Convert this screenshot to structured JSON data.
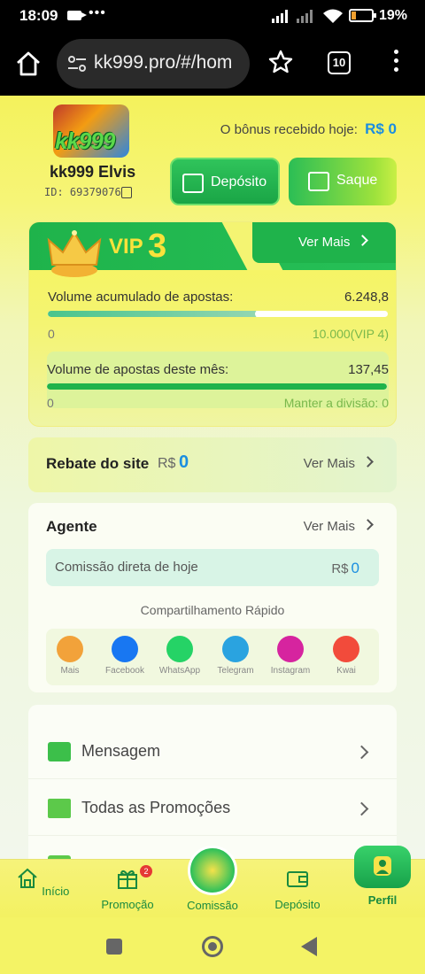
{
  "status": {
    "time": "18:09",
    "dots": "•••",
    "battery": "19%"
  },
  "browser": {
    "url": "kk999.pro/#/hom",
    "tabs_count": "10"
  },
  "profile": {
    "logo_text": "kk999",
    "username": "kk999 Elvis",
    "id_label": "ID: 69379076",
    "bonus_label": "O bônus recebido hoje:",
    "bonus_value": "R$ 0"
  },
  "actions": {
    "deposit": "Depósito",
    "withdraw": "Saque"
  },
  "vip": {
    "label": "VIP",
    "level": "3",
    "ver_mais": "Ver Mais",
    "acc_label": "Volume acumulado de apostas:",
    "acc_value": "6.248,8",
    "acc_min": "0",
    "acc_target": "10.000(VIP 4)",
    "acc_progress": 0.62,
    "month_label": "Volume de apostas deste mês:",
    "month_value": "137,45",
    "month_min": "0",
    "month_keep": "Manter a divisão: 0",
    "month_progress": 1.0
  },
  "rebate": {
    "title": "Rebate do site",
    "currency": "R$",
    "value": "0",
    "ver_mais": "Ver Mais"
  },
  "agent": {
    "title": "Agente",
    "ver_mais": "Ver Mais",
    "commission_label": "Comissão direta de hoje",
    "commission_currency": "R$",
    "commission_value": "0",
    "share_title": "Compartilhamento Rápido",
    "share": [
      {
        "label": "Mais",
        "color": "#f2a23a"
      },
      {
        "label": "Facebook",
        "color": "#1877f2"
      },
      {
        "label": "WhatsApp",
        "color": "#25d366"
      },
      {
        "label": "Telegram",
        "color": "#2aa3e0"
      },
      {
        "label": "Instagram",
        "color": "#d6249f"
      },
      {
        "label": "Kwai",
        "color": "#f24b3b"
      }
    ]
  },
  "menu": [
    {
      "label": "Mensagem"
    },
    {
      "label": "Todas as Promoções"
    },
    {
      "label": ""
    }
  ],
  "nav": {
    "inicio": "Início",
    "promocao": "Promoção",
    "promocao_badge": "2",
    "comissao": "Comissão",
    "deposito": "Depósito",
    "perfil": "Perfil"
  },
  "colors": {
    "accent_green": "#1fb34b",
    "value_blue": "#1b8ee0",
    "page_yellow": "#f4f25c"
  }
}
